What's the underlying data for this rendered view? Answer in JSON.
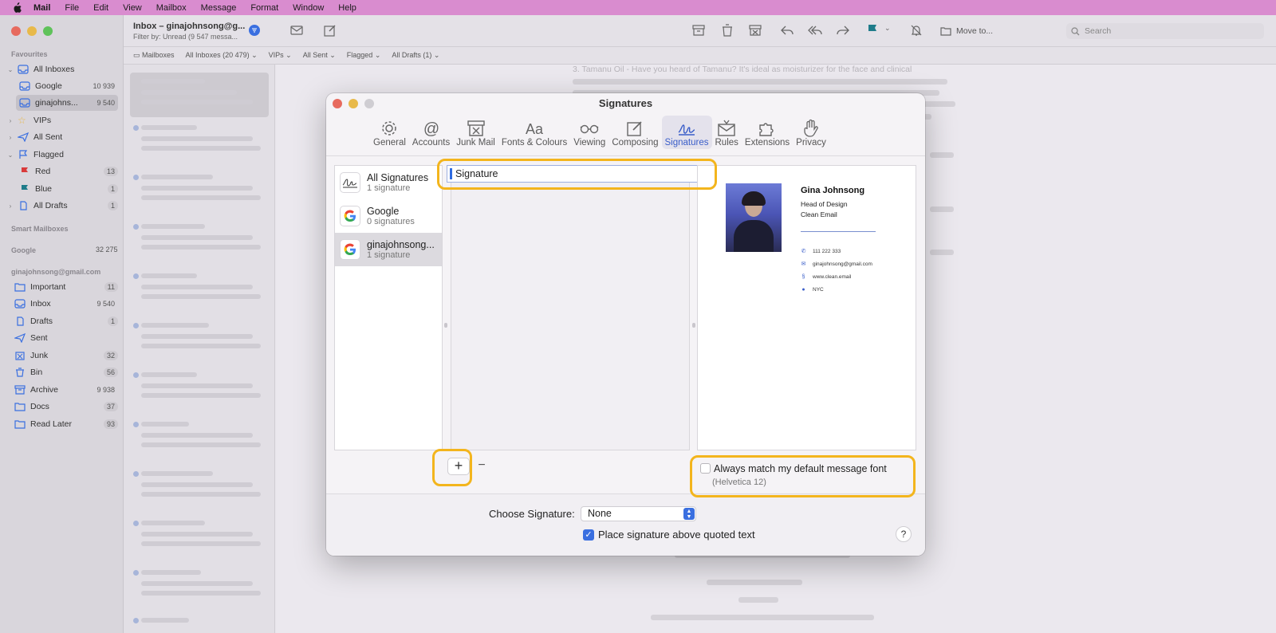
{
  "menubar": {
    "items": [
      "Mail",
      "File",
      "Edit",
      "View",
      "Mailbox",
      "Message",
      "Format",
      "Window",
      "Help"
    ]
  },
  "sidebar": {
    "favourites_heading": "Favourites",
    "all_inboxes": "All Inboxes",
    "google": {
      "label": "Google",
      "count": "10 939"
    },
    "gina": {
      "label": "ginajohns...",
      "count": "9 540"
    },
    "vips": "VIPs",
    "all_sent": "All Sent",
    "flagged": "Flagged",
    "red": {
      "label": "Red",
      "count": "13"
    },
    "blue": {
      "label": "Blue",
      "count": "1"
    },
    "all_drafts": {
      "label": "All Drafts",
      "count": "1"
    },
    "smart_heading": "Smart Mailboxes",
    "google_heading": "Google",
    "google_heading_count": "32 275",
    "account_heading": "ginajohnsong@gmail.com",
    "folders": [
      {
        "label": "Important",
        "count": "11"
      },
      {
        "label": "Inbox",
        "count": "9 540"
      },
      {
        "label": "Drafts",
        "count": "1"
      },
      {
        "label": "Sent",
        "count": ""
      },
      {
        "label": "Junk",
        "count": "32"
      },
      {
        "label": "Bin",
        "count": "56"
      },
      {
        "label": "Archive",
        "count": "9 938"
      },
      {
        "label": "Docs",
        "count": "37"
      },
      {
        "label": "Read Later",
        "count": "93"
      }
    ]
  },
  "toolbar": {
    "title": "Inbox – ginajohnsong@g...",
    "subtitle": "Filter by: Unread (9 547 messa...",
    "move_to": "Move to...",
    "search_placeholder": "Search"
  },
  "favbar": {
    "items": [
      "Mailboxes",
      "All Inboxes (20 479)",
      "VIPs",
      "All Sent",
      "Flagged",
      "All Drafts (1)"
    ]
  },
  "reader": {
    "line1": "3. Tamanu Oil - Have you heard of Tamanu? It's ideal as moisturizer for the face and clinical"
  },
  "dialog": {
    "title": "Signatures",
    "prefs": [
      {
        "label": "General",
        "icon": "gear-icon"
      },
      {
        "label": "Accounts",
        "icon": "at-icon"
      },
      {
        "label": "Junk Mail",
        "icon": "junk-mail-icon"
      },
      {
        "label": "Fonts & Colours",
        "icon": "fonts-icon"
      },
      {
        "label": "Viewing",
        "icon": "glasses-icon"
      },
      {
        "label": "Composing",
        "icon": "compose-icon"
      },
      {
        "label": "Signatures",
        "icon": "signature-icon"
      },
      {
        "label": "Rules",
        "icon": "rules-icon"
      },
      {
        "label": "Extensions",
        "icon": "puzzle-icon"
      },
      {
        "label": "Privacy",
        "icon": "hand-icon"
      }
    ],
    "active_pref": "Signatures",
    "accounts": [
      {
        "name": "All Signatures",
        "sub": "1 signature"
      },
      {
        "name": "Google",
        "sub": "0 signatures"
      },
      {
        "name": "ginajohnsong...",
        "sub": "1 signature"
      }
    ],
    "signature_name": "Signature",
    "preview": {
      "name": "Gina Johnsong",
      "role": "Head of Design",
      "company": "Clean Email",
      "phone": "111 222 333",
      "email": "ginajohnsong@gmail.com",
      "web": "www.clean.email",
      "location": "NYC"
    },
    "add_label": "+",
    "remove_label": "−",
    "match_font_label": "Always match my default message font",
    "match_font_sub": "(Helvetica 12)",
    "choose_label": "Choose Signature:",
    "choose_value": "None",
    "place_above_label": "Place signature above quoted text",
    "help_label": "?"
  },
  "colors": {
    "highlight": "#f3b51d",
    "accent": "#3a6fe0",
    "menubar": "#d98ccf"
  }
}
